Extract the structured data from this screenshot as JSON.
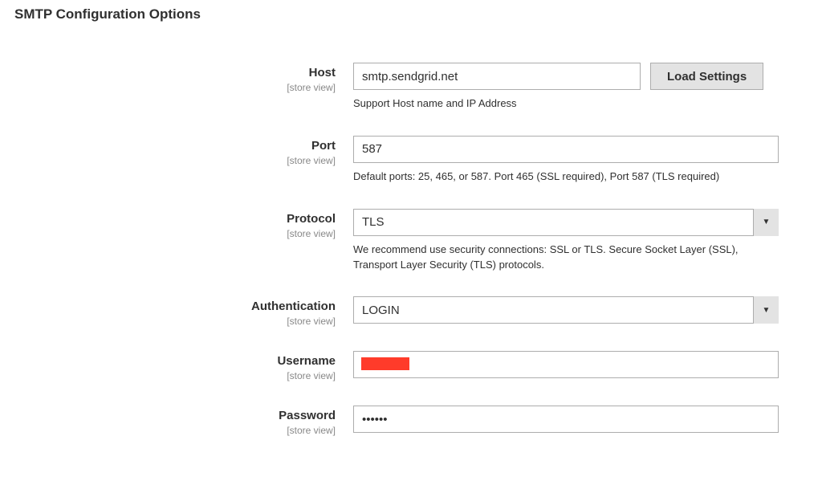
{
  "section_title": "SMTP Configuration Options",
  "scope_label": "[store view]",
  "host": {
    "label": "Host",
    "value": "smtp.sendgrid.net",
    "help": "Support Host name and IP Address",
    "load_button": "Load Settings"
  },
  "port": {
    "label": "Port",
    "value": "587",
    "help": "Default ports: 25, 465, or 587. Port 465 (SSL required), Port 587 (TLS required)"
  },
  "protocol": {
    "label": "Protocol",
    "value": "TLS",
    "help": "We recommend use security connections: SSL or TLS. Secure Socket Layer (SSL), Transport Layer Security (TLS) protocols."
  },
  "authentication": {
    "label": "Authentication",
    "value": "LOGIN"
  },
  "username": {
    "label": "Username",
    "value": ""
  },
  "password": {
    "label": "Password",
    "value": "••••••"
  }
}
